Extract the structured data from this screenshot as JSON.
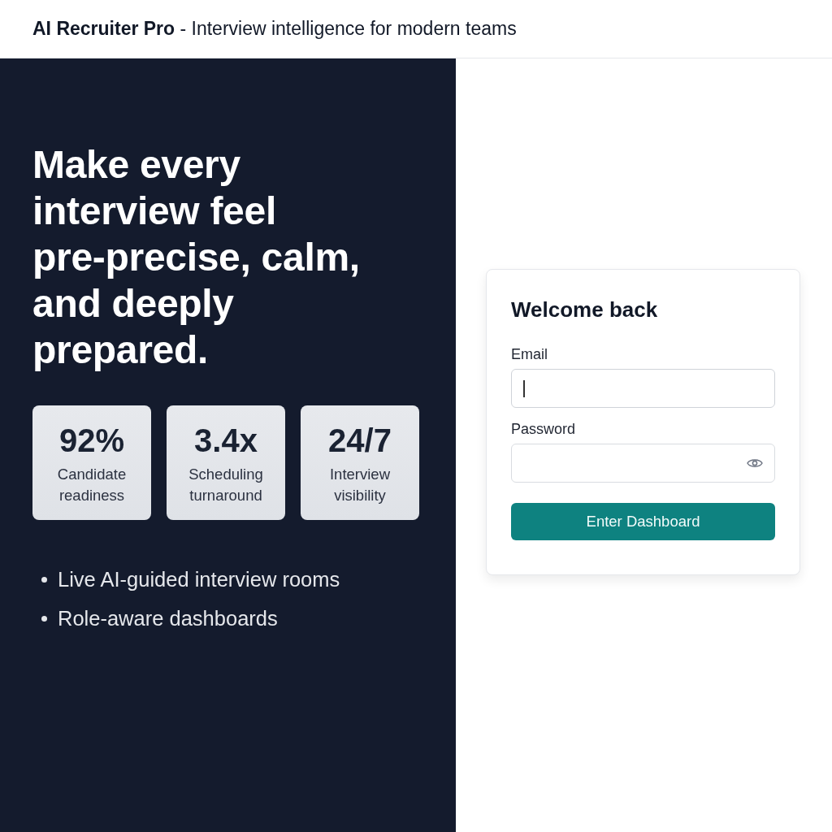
{
  "header": {
    "title": "**AI Recruiter Pro** - Interview intelligence for modern teams"
  },
  "hero": {
    "headline": "Make every interview feel pre-precise, calm, and deeply prepared.",
    "stats": [
      {
        "value": "92%",
        "label": "Candidate readiness"
      },
      {
        "value": "3.4x",
        "label": "Scheduling turnaround"
      },
      {
        "value": "24/7",
        "label": "Interview visibility"
      }
    ],
    "features": [
      "Live AI-guided interview rooms",
      "Role-aware dashboards"
    ]
  },
  "login": {
    "title": "Welcome back",
    "fields": [
      {
        "kind": "text",
        "label": "Email",
        "focused": true
      },
      {
        "kind": "password",
        "label": "Password",
        "focused": false
      }
    ],
    "button": "Enter Dashboard"
  }
}
